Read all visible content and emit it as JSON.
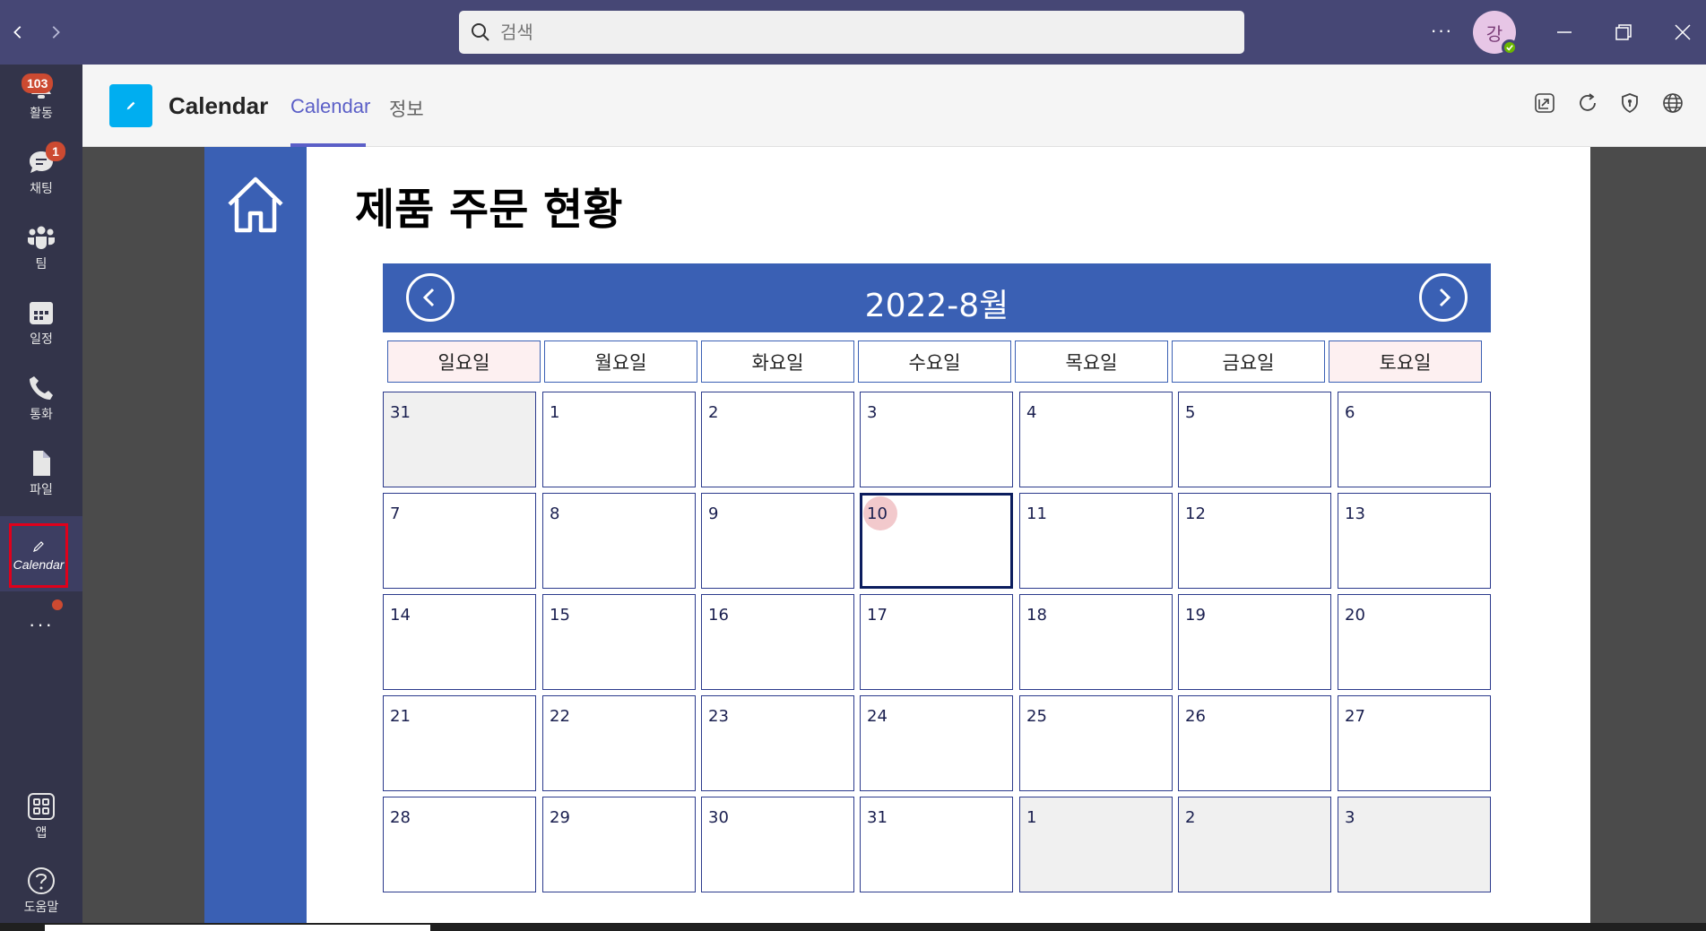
{
  "titlebar": {
    "search_placeholder": "검색",
    "more_label": "···",
    "avatar_initial": "강"
  },
  "rail": {
    "items": [
      {
        "label": "활동",
        "icon": "bell-icon",
        "badge": "103"
      },
      {
        "label": "채팅",
        "icon": "chat-icon",
        "badge": "1"
      },
      {
        "label": "팀",
        "icon": "teams-icon",
        "badge": ""
      },
      {
        "label": "일정",
        "icon": "calendar-icon",
        "badge": ""
      },
      {
        "label": "통화",
        "icon": "phone-icon",
        "badge": ""
      },
      {
        "label": "파일",
        "icon": "file-icon",
        "badge": ""
      }
    ],
    "active_app": {
      "label": "Calendar",
      "icon": "pencil-icon"
    },
    "more_label": "···",
    "bottom": [
      {
        "label": "앱",
        "icon": "apps-icon"
      },
      {
        "label": "도움말",
        "icon": "help-icon"
      }
    ]
  },
  "tabheader": {
    "app_name": "Calendar",
    "tabs": [
      {
        "label": "Calendar",
        "active": true
      },
      {
        "label": "정보",
        "active": false
      }
    ],
    "actions": [
      "popout-icon",
      "refresh-icon",
      "shield-icon",
      "globe-icon"
    ]
  },
  "page": {
    "title": "제품 주문 현황"
  },
  "calendar": {
    "month_label": "2022-8월",
    "weekdays": [
      "일요일",
      "월요일",
      "화요일",
      "수요일",
      "목요일",
      "금요일",
      "토요일"
    ],
    "weeks": [
      [
        {
          "n": "31",
          "other": true
        },
        {
          "n": "1"
        },
        {
          "n": "2"
        },
        {
          "n": "3"
        },
        {
          "n": "4"
        },
        {
          "n": "5"
        },
        {
          "n": "6"
        }
      ],
      [
        {
          "n": "7"
        },
        {
          "n": "8"
        },
        {
          "n": "9"
        },
        {
          "n": "10",
          "selected": true,
          "today": true
        },
        {
          "n": "11"
        },
        {
          "n": "12"
        },
        {
          "n": "13"
        }
      ],
      [
        {
          "n": "14"
        },
        {
          "n": "15"
        },
        {
          "n": "16"
        },
        {
          "n": "17"
        },
        {
          "n": "18"
        },
        {
          "n": "19"
        },
        {
          "n": "20"
        }
      ],
      [
        {
          "n": "21"
        },
        {
          "n": "22"
        },
        {
          "n": "23"
        },
        {
          "n": "24"
        },
        {
          "n": "25"
        },
        {
          "n": "26"
        },
        {
          "n": "27"
        }
      ],
      [
        {
          "n": "28"
        },
        {
          "n": "29"
        },
        {
          "n": "30"
        },
        {
          "n": "31"
        },
        {
          "n": "1",
          "other": true
        },
        {
          "n": "2",
          "other": true
        },
        {
          "n": "3",
          "other": true
        }
      ]
    ],
    "colors": {
      "primary": "#3a60b4",
      "cell_border": "#2b3a8c",
      "weekend_bg": "#fdf0f1",
      "other_month_bg": "#f0f0f0",
      "today_dot": "#f2c9cc"
    }
  }
}
